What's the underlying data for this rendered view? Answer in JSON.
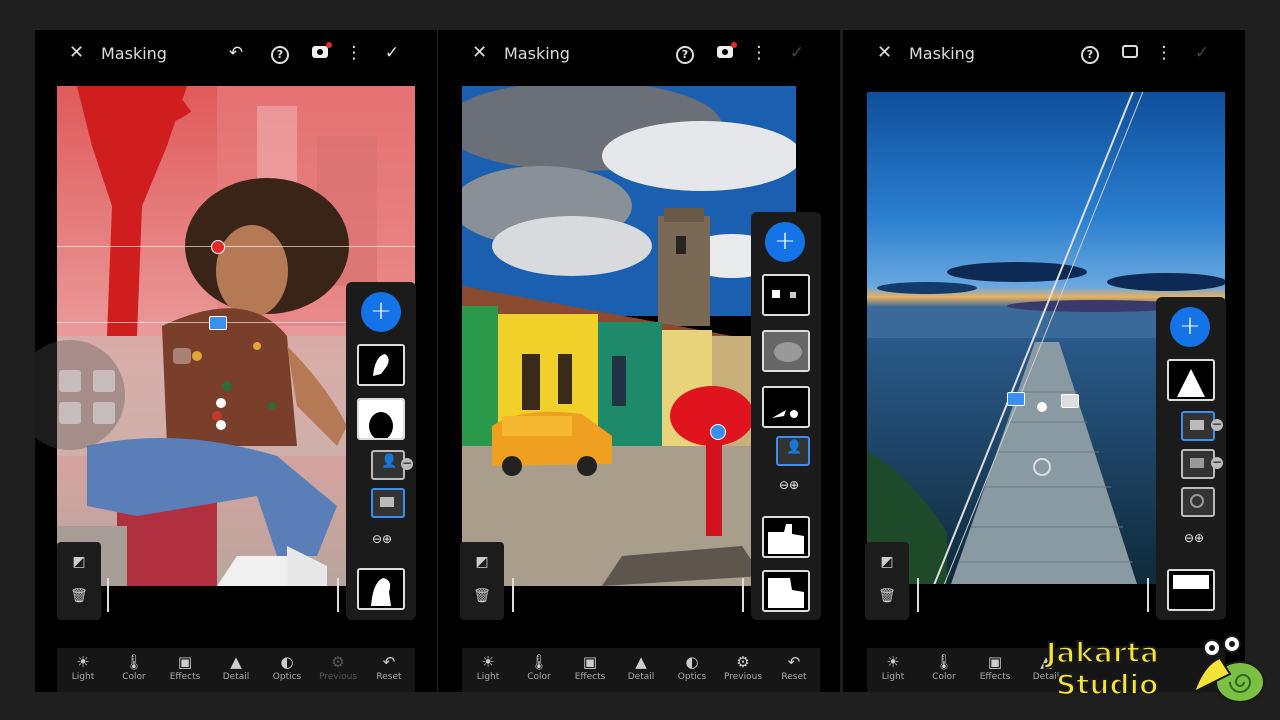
{
  "screens": [
    {
      "title": "Masking",
      "toolbar_icons": [
        "close-icon",
        "undo-icon",
        "help-icon",
        "mask-overlay-icon",
        "more-icon",
        "check-icon"
      ],
      "tools": [
        {
          "label": "Light",
          "icon": "☀",
          "dim": false
        },
        {
          "label": "Color",
          "icon": "🌡",
          "dim": false
        },
        {
          "label": "Effects",
          "icon": "▣",
          "dim": false
        },
        {
          "label": "Detail",
          "icon": "▲",
          "dim": false
        },
        {
          "label": "Optics",
          "icon": "◐",
          "dim": false
        },
        {
          "label": "Previous",
          "icon": "⚙",
          "dim": true
        },
        {
          "label": "Reset",
          "icon": "↶",
          "dim": false
        }
      ]
    },
    {
      "title": "Masking",
      "toolbar_icons": [
        "close-icon",
        "help-icon",
        "mask-overlay-icon",
        "more-icon",
        "check-icon"
      ],
      "tools": [
        {
          "label": "Light",
          "icon": "☀",
          "dim": false
        },
        {
          "label": "Color",
          "icon": "🌡",
          "dim": false
        },
        {
          "label": "Effects",
          "icon": "▣",
          "dim": false
        },
        {
          "label": "Detail",
          "icon": "▲",
          "dim": false
        },
        {
          "label": "Optics",
          "icon": "◐",
          "dim": false
        },
        {
          "label": "Previous",
          "icon": "⚙",
          "dim": false
        },
        {
          "label": "Reset",
          "icon": "↶",
          "dim": false
        }
      ]
    },
    {
      "title": "Masking",
      "toolbar_icons": [
        "close-icon",
        "help-icon",
        "mask-overlay-off-icon",
        "more-icon",
        "check-icon"
      ],
      "tools": [
        {
          "label": "Light",
          "icon": "☀",
          "dim": false
        },
        {
          "label": "Color",
          "icon": "🌡",
          "dim": false
        },
        {
          "label": "Effects",
          "icon": "▣",
          "dim": false
        },
        {
          "label": "Detail",
          "icon": "▲",
          "dim": false
        }
      ]
    }
  ],
  "add_label": "+",
  "watermark": {
    "line1": "Jakarta",
    "line2": "Studio"
  },
  "colors": {
    "accent": "#1473e6",
    "mask_red": "#e12b2b",
    "watermark_yellow": "#f5e23a"
  }
}
